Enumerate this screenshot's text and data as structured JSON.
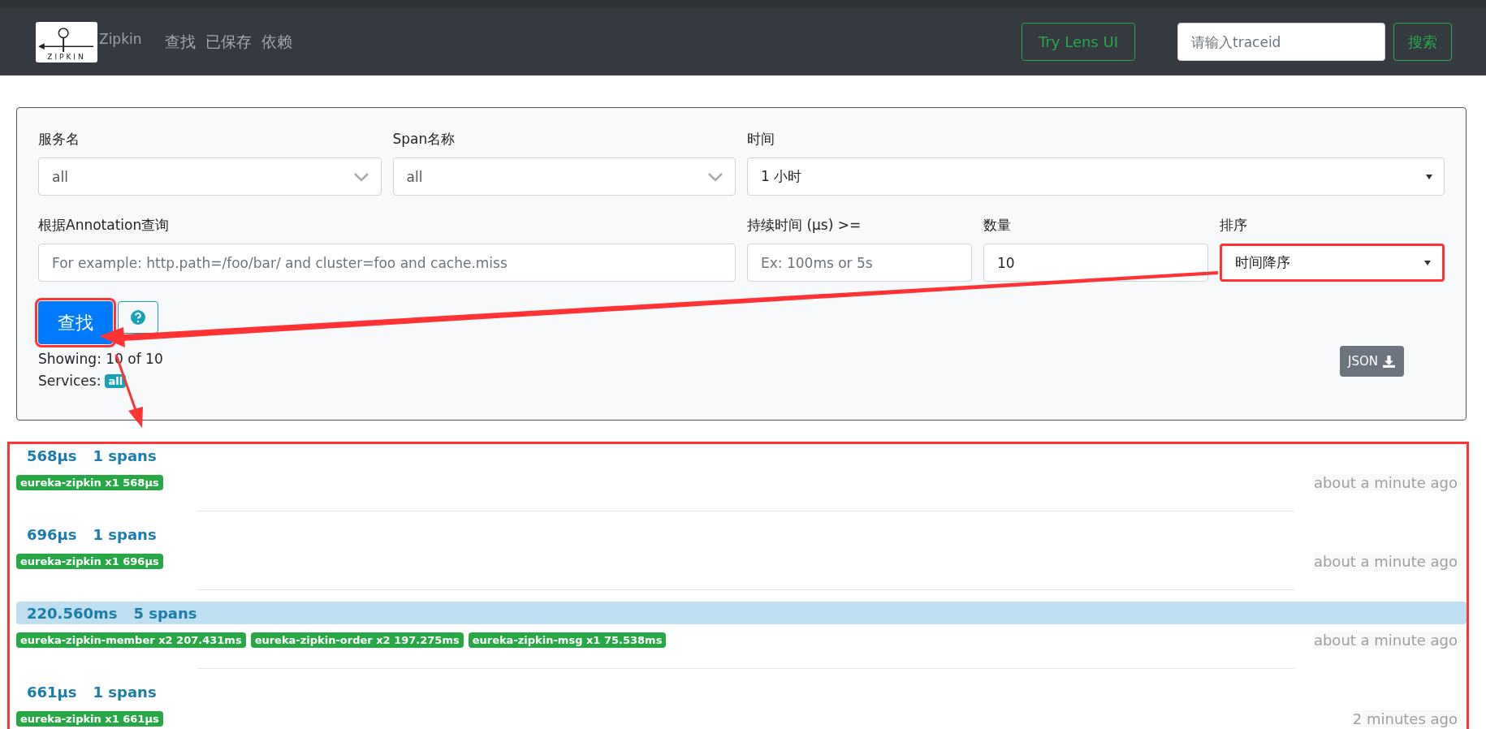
{
  "header": {
    "logo_text": "ZIPKIN",
    "brand": "Zipkin",
    "nav": [
      {
        "label": "查找"
      },
      {
        "label": "已保存"
      },
      {
        "label": "依赖"
      }
    ],
    "lens_button": "Try Lens UI",
    "search": {
      "placeholder": "请输入traceid"
    },
    "search_button": "搜索"
  },
  "form": {
    "fields": [
      {
        "label": "服务名",
        "kind": "select",
        "value": "all",
        "highlighted": false
      },
      {
        "label": "Span名称",
        "kind": "select",
        "value": "all",
        "highlighted": false
      },
      {
        "label": "时间",
        "kind": "native",
        "value": "1 小时",
        "highlighted": false
      },
      {
        "label": "根据Annotation查询",
        "kind": "input",
        "placeholder": "For example: http.path=/foo/bar/ and cluster=foo and cache.miss",
        "highlighted": false
      },
      {
        "label": "持续时间 (μs) >=",
        "kind": "input",
        "placeholder": "Ex: 100ms or 5s",
        "highlighted": false
      },
      {
        "label": "数量",
        "kind": "input",
        "value": "10",
        "highlighted": false
      },
      {
        "label": "排序",
        "kind": "native",
        "value": "时间降序",
        "highlighted": true
      }
    ],
    "find_button": {
      "label": "查找",
      "highlighted": true
    },
    "showing": "Showing: 10 of 10",
    "services_label": "Services:",
    "services_badge": "all",
    "json_button": "JSON"
  },
  "traces": {
    "highlighted": true,
    "items": [
      {
        "duration": "568μs",
        "spans": "1 spans",
        "selected": false,
        "services": [
          "eureka-zipkin x1 568μs"
        ],
        "time": "about a minute ago"
      },
      {
        "duration": "696μs",
        "spans": "1 spans",
        "selected": false,
        "services": [
          "eureka-zipkin x1 696μs"
        ],
        "time": "about a minute ago"
      },
      {
        "duration": "220.560ms",
        "spans": "5 spans",
        "selected": true,
        "services": [
          "eureka-zipkin-member x2 207.431ms",
          "eureka-zipkin-order x2 197.275ms",
          "eureka-zipkin-msg x1 75.538ms"
        ],
        "time": "about a minute ago"
      },
      {
        "duration": "661μs",
        "spans": "1 spans",
        "selected": false,
        "services": [
          "eureka-zipkin x1 661μs"
        ],
        "time": "2 minutes ago"
      }
    ]
  }
}
